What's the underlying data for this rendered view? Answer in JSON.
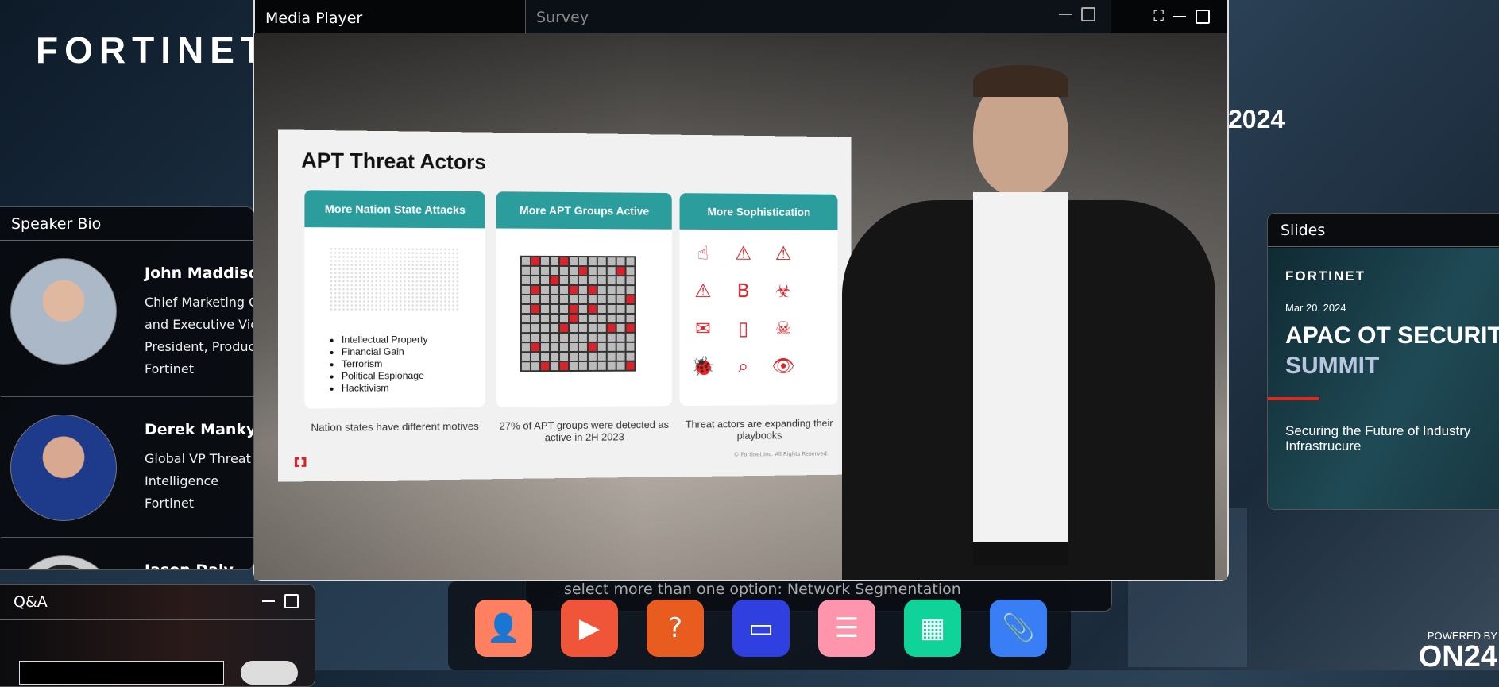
{
  "brand": {
    "logo": "FORTINET",
    "year_fragment": "2024"
  },
  "media_player": {
    "title": "Media Player",
    "icons": [
      "expand-icon",
      "minimize-icon",
      "maximize-icon"
    ]
  },
  "survey": {
    "title": "Survey",
    "text": "select more than one option: Network Segmentation"
  },
  "video_slide": {
    "title": "APT Threat Actors",
    "cards": [
      {
        "heading": "More Nation State Attacks",
        "bullets": [
          "Intellectual Property",
          "Financial Gain",
          "Terrorism",
          "Political Espionage",
          "Hacktivism"
        ],
        "caption": "Nation states have different motives"
      },
      {
        "heading": "More APT Groups Active",
        "caption": "27% of APT groups were detected as active in 2H 2023"
      },
      {
        "heading": "More Sophistication",
        "caption": "Threat actors are expanding their playbooks"
      }
    ],
    "footer": "© Fortinet Inc. All Rights Reserved."
  },
  "speaker_bio": {
    "title": "Speaker Bio",
    "speakers": [
      {
        "name": "John Maddison",
        "title": [
          "Chief Marketing Officer",
          "and Executive Vice",
          "President, Products",
          "Fortinet"
        ]
      },
      {
        "name": "Derek Manky",
        "title": [
          "Global VP Threat",
          "Intelligence",
          "Fortinet"
        ]
      },
      {
        "name": "Jason Daly",
        "title": []
      }
    ]
  },
  "slides": {
    "title": "Slides",
    "logo": "FORTINET",
    "date": "Mar 20, 2024",
    "headline1": "APAC OT SECURITY",
    "headline2": "SUMMIT",
    "subtitle1": "Securing the Future of Industry",
    "subtitle2": "Infrastrucure",
    "accent": "#e0281f"
  },
  "qa": {
    "title": "Q&A"
  },
  "dock": [
    {
      "name": "speaker-bio",
      "icon": "person-icon",
      "color": "#ff8060"
    },
    {
      "name": "media-player",
      "icon": "play-icon",
      "color": "#f0553a"
    },
    {
      "name": "qa",
      "icon": "question-chat-icon",
      "color": "#e85c20"
    },
    {
      "name": "slides",
      "icon": "presentation-icon",
      "color": "#2f3fe0"
    },
    {
      "name": "survey",
      "icon": "clipboard-list-icon",
      "color": "#ff94ad"
    },
    {
      "name": "calendar",
      "icon": "calendar-icon",
      "color": "#10d39a"
    },
    {
      "name": "resources",
      "icon": "paperclip-icon",
      "color": "#3a7ef5"
    }
  ],
  "powered_by": {
    "label": "POWERED BY",
    "logo": "ON24"
  }
}
